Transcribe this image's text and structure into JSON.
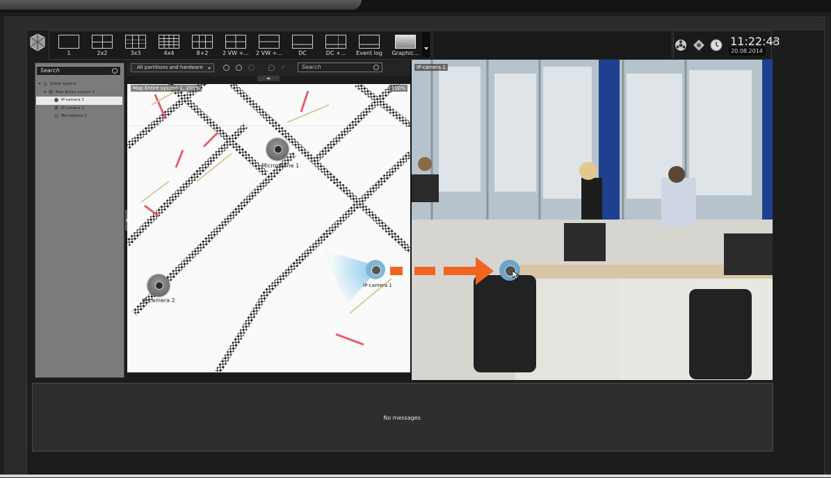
{
  "toolbar": {
    "layouts": [
      {
        "label": "1",
        "icon": "layout-1-icon"
      },
      {
        "label": "2x2",
        "icon": "layout-2x2-icon"
      },
      {
        "label": "3x3",
        "icon": "layout-3x3-icon"
      },
      {
        "label": "4x4",
        "icon": "layout-4x4-icon"
      },
      {
        "label": "8+2",
        "icon": "layout-8plus2-icon"
      },
      {
        "label": "2 VW +...",
        "icon": "layout-2vw-a-icon"
      },
      {
        "label": "2 VW +...",
        "icon": "layout-2vw-b-icon"
      },
      {
        "label": "DC",
        "icon": "layout-dc-icon"
      },
      {
        "label": "DC +...",
        "icon": "layout-dc-plus-icon"
      },
      {
        "label": "Event log",
        "icon": "event-log-icon"
      },
      {
        "label": "Graphic...",
        "icon": "graphic-icon"
      }
    ]
  },
  "status": {
    "time": "11:22:43",
    "date": "20.08.2014"
  },
  "left_panel": {
    "search_placeholder": "Search",
    "tree": [
      {
        "label": "Entire system",
        "level": 0
      },
      {
        "label": "Map Entire system 1",
        "level": 1
      },
      {
        "label": "IP-camera 1",
        "level": 2,
        "selected": true
      },
      {
        "label": "IP-camera 2",
        "level": 2
      },
      {
        "label": "Microphone 1",
        "level": 2
      }
    ]
  },
  "map_panel": {
    "filter_value": "All partitions and hardware",
    "search_placeholder": "Search",
    "title": "Map Entire system 1, 200%",
    "zoom": "100%",
    "devices": {
      "microphone": "Microphone 1",
      "camera1": "IP-camera 1",
      "camera2": "IP-camera 2"
    }
  },
  "video_panel": {
    "title": "IP-camera 1"
  },
  "messages": {
    "text": "No messages"
  },
  "colors": {
    "accent_arrow": "#f26422",
    "camera_highlight": "#6ca4c8"
  }
}
